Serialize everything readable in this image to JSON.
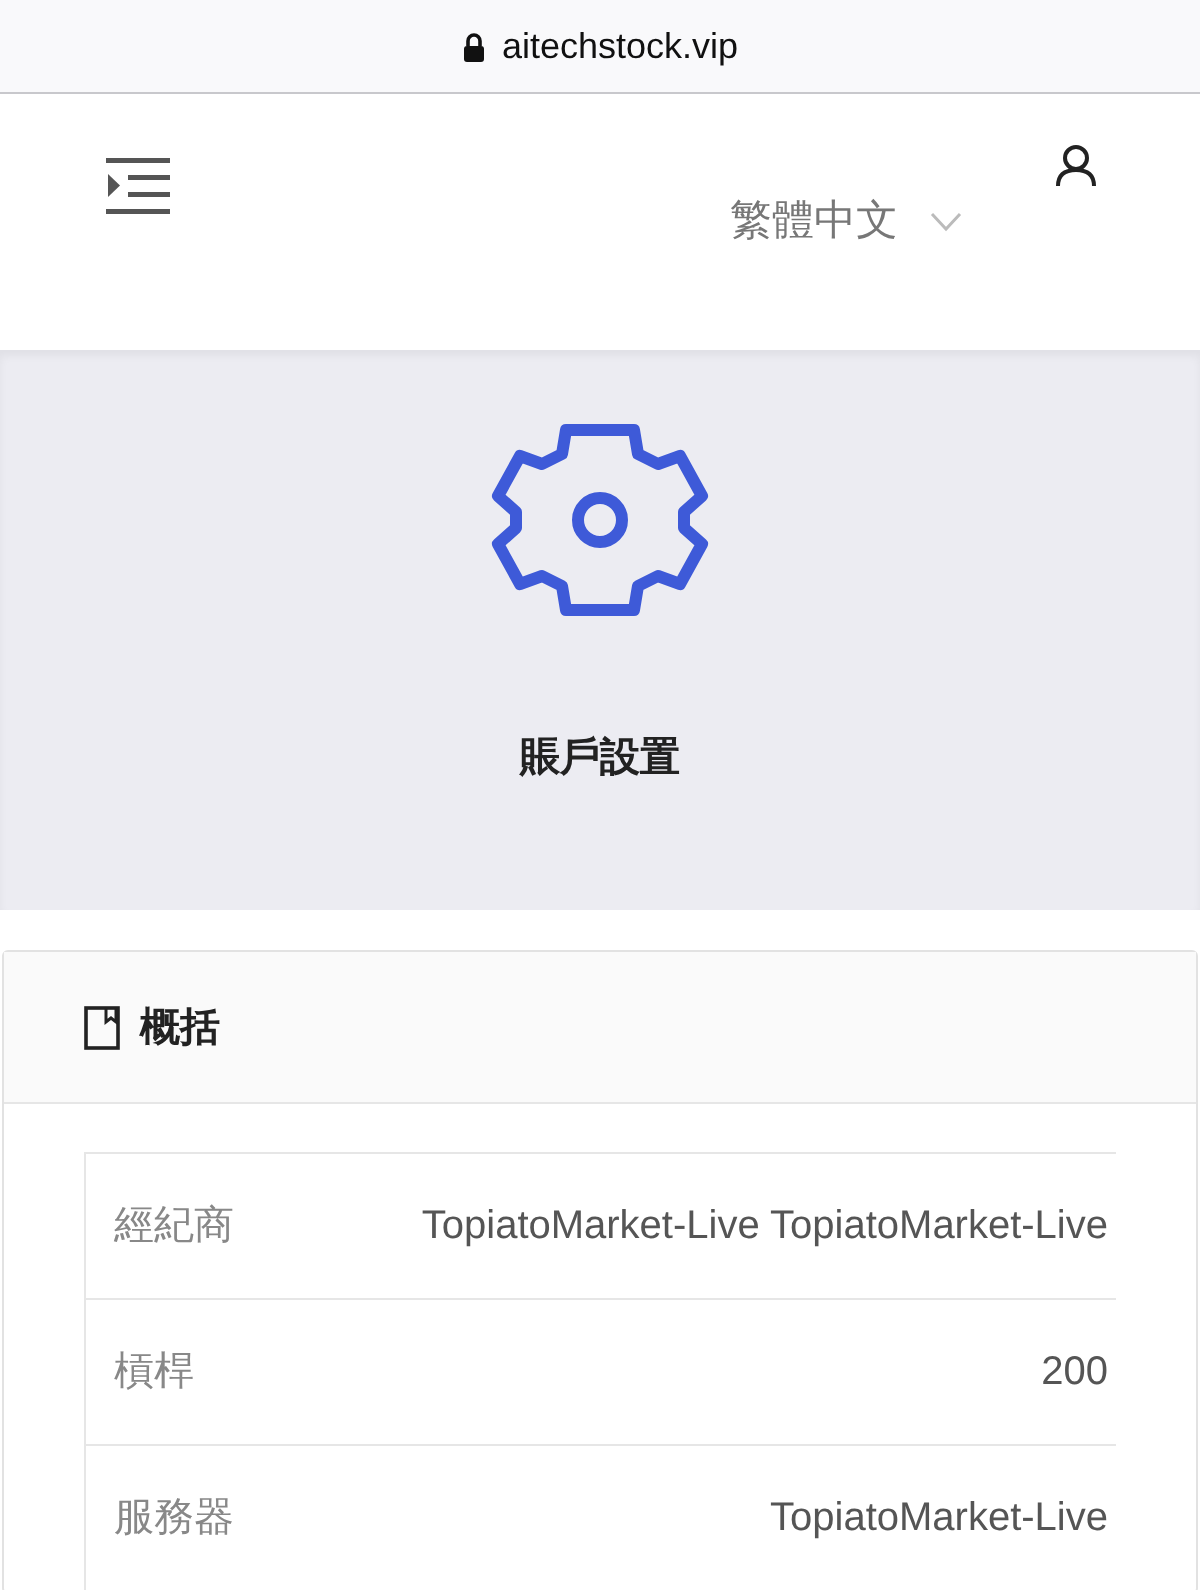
{
  "address_bar": {
    "url": "aitechstock.vip"
  },
  "header": {
    "language": "繁體中文"
  },
  "hero": {
    "title": "賬戶設置"
  },
  "card": {
    "title": "概括",
    "rows": [
      {
        "label": "經紀商",
        "value": "TopiatoMarket-Live TopiatoMarket-Live"
      },
      {
        "label": "槓桿",
        "value": "200"
      },
      {
        "label": "服務器",
        "value": "TopiatoMarket-Live"
      }
    ]
  }
}
